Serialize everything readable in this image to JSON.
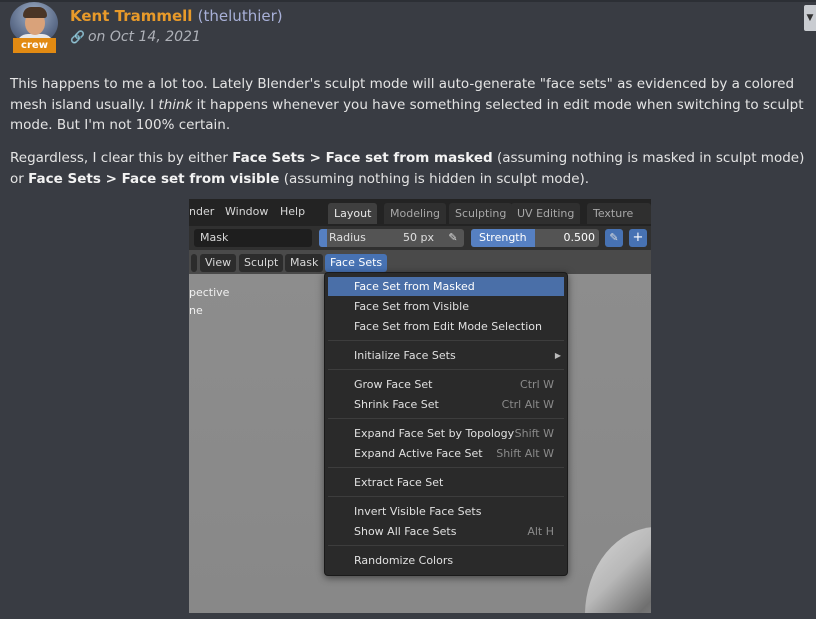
{
  "post": {
    "author_name": "Kent Trammell",
    "author_handle": "(theluthier)",
    "badge": "crew",
    "date": "on Oct 14, 2021",
    "p1_a": "This happens to me a lot too. Lately Blender's sculpt mode will auto-generate \"face sets\" as evidenced by a colored mesh island usually. I ",
    "p1_em": "think",
    "p1_b": " it happens whenever you have something selected in edit mode when switching to sculpt mode. But I'm not 100% certain.",
    "p2_a": "Regardless, I clear this by either ",
    "p2_b1": "Face Sets > Face set from masked",
    "p2_c": " (assuming nothing is masked in sculpt mode) or ",
    "p2_b2": "Face Sets > Face set from visible",
    "p2_d": " (assuming nothing is hidden in sculpt mode)."
  },
  "blender": {
    "top_menu": [
      "nder",
      "Window",
      "Help"
    ],
    "workspace_tabs": [
      "Layout",
      "Modeling",
      "Sculpting",
      "UV Editing",
      "Texture Pair"
    ],
    "mask_label": "Mask",
    "radius_label": "Radius",
    "radius_value": "50 px",
    "strength_label": "Strength",
    "strength_value": "0.500",
    "strength_level": 0.5,
    "header_menus": [
      "View",
      "Sculpt",
      "Mask",
      "Face Sets"
    ],
    "overlay_lines": [
      "pective",
      "ne"
    ],
    "menu": [
      {
        "label": "Face Set from Masked",
        "shortcut": ""
      },
      {
        "label": "Face Set from Visible",
        "shortcut": ""
      },
      {
        "label": "Face Set from Edit Mode Selection",
        "shortcut": ""
      },
      {
        "label": "Initialize Face Sets",
        "shortcut": ""
      },
      {
        "label": "Grow Face Set",
        "shortcut": "Ctrl W"
      },
      {
        "label": "Shrink Face Set",
        "shortcut": "Ctrl Alt W"
      },
      {
        "label": "Expand Face Set by Topology",
        "shortcut": "Shift W"
      },
      {
        "label": "Expand Active Face Set",
        "shortcut": "Shift Alt W"
      },
      {
        "label": "Extract Face Set",
        "shortcut": ""
      },
      {
        "label": "Invert Visible Face Sets",
        "shortcut": ""
      },
      {
        "label": "Show All Face Sets",
        "shortcut": "Alt H"
      },
      {
        "label": "Randomize Colors",
        "shortcut": ""
      }
    ]
  }
}
